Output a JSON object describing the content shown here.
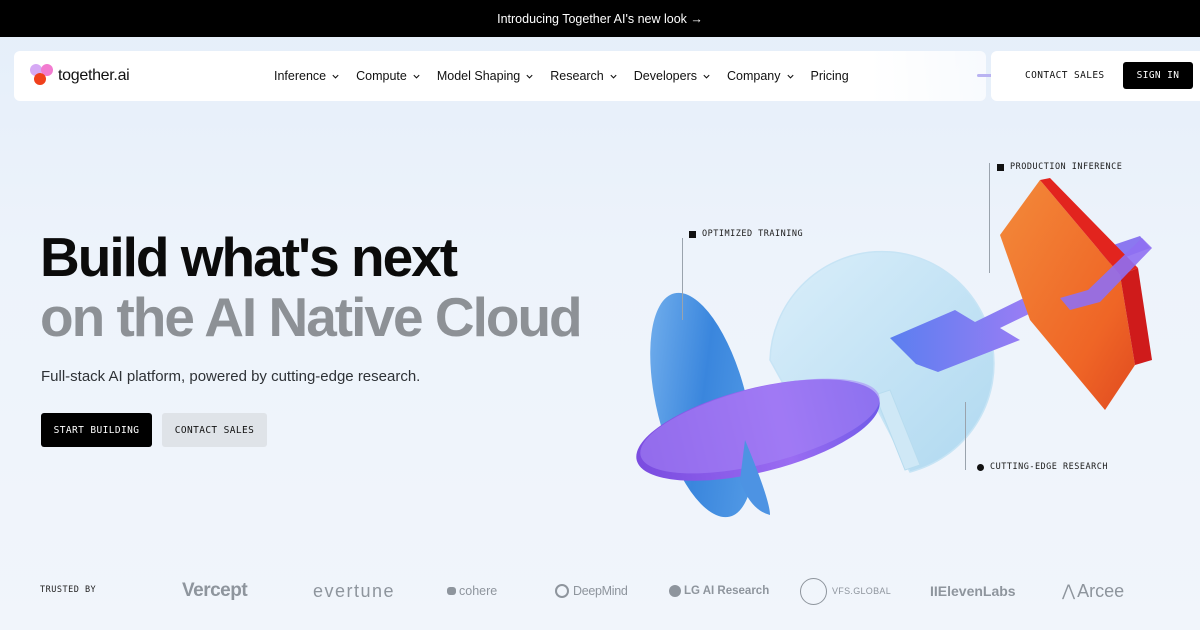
{
  "announcement": {
    "text": "Introducing Together AI's new look →"
  },
  "brand": {
    "name": "together.ai"
  },
  "nav": {
    "items": [
      {
        "label": "Inference",
        "dropdown": true
      },
      {
        "label": "Compute",
        "dropdown": true
      },
      {
        "label": "Model Shaping",
        "dropdown": true
      },
      {
        "label": "Research",
        "dropdown": true
      },
      {
        "label": "Developers",
        "dropdown": true
      },
      {
        "label": "Company",
        "dropdown": true
      },
      {
        "label": "Pricing",
        "dropdown": false
      }
    ],
    "contact_label": "CONTACT SALES",
    "signin_label": "SIGN IN"
  },
  "hero": {
    "title_line1": "Build what's next",
    "title_line2": "on the AI Native Cloud",
    "description": "Full-stack AI platform, powered by cutting-edge research.",
    "primary_cta": "START BUILDING",
    "secondary_cta": "CONTACT SALES"
  },
  "illustration": {
    "labels": {
      "training": "OPTIMIZED TRAINING",
      "production": "PRODUCTION INFERENCE",
      "research": "CUTTING-EDGE RESEARCH"
    }
  },
  "trusted": {
    "label": "TRUSTED BY",
    "logos": [
      "Vercept",
      "evertune",
      "cohere",
      "DeepMind",
      "LG AI Research",
      "VFS.GLOBAL",
      "IIElevenLabs",
      "Arcee"
    ]
  },
  "colors": {
    "accent_purple": "#8a5cf0",
    "accent_orange": "#f06a2a",
    "accent_red": "#e0201e",
    "accent_blue": "#3b8de0",
    "glass_blue": "#bfe2f5"
  }
}
